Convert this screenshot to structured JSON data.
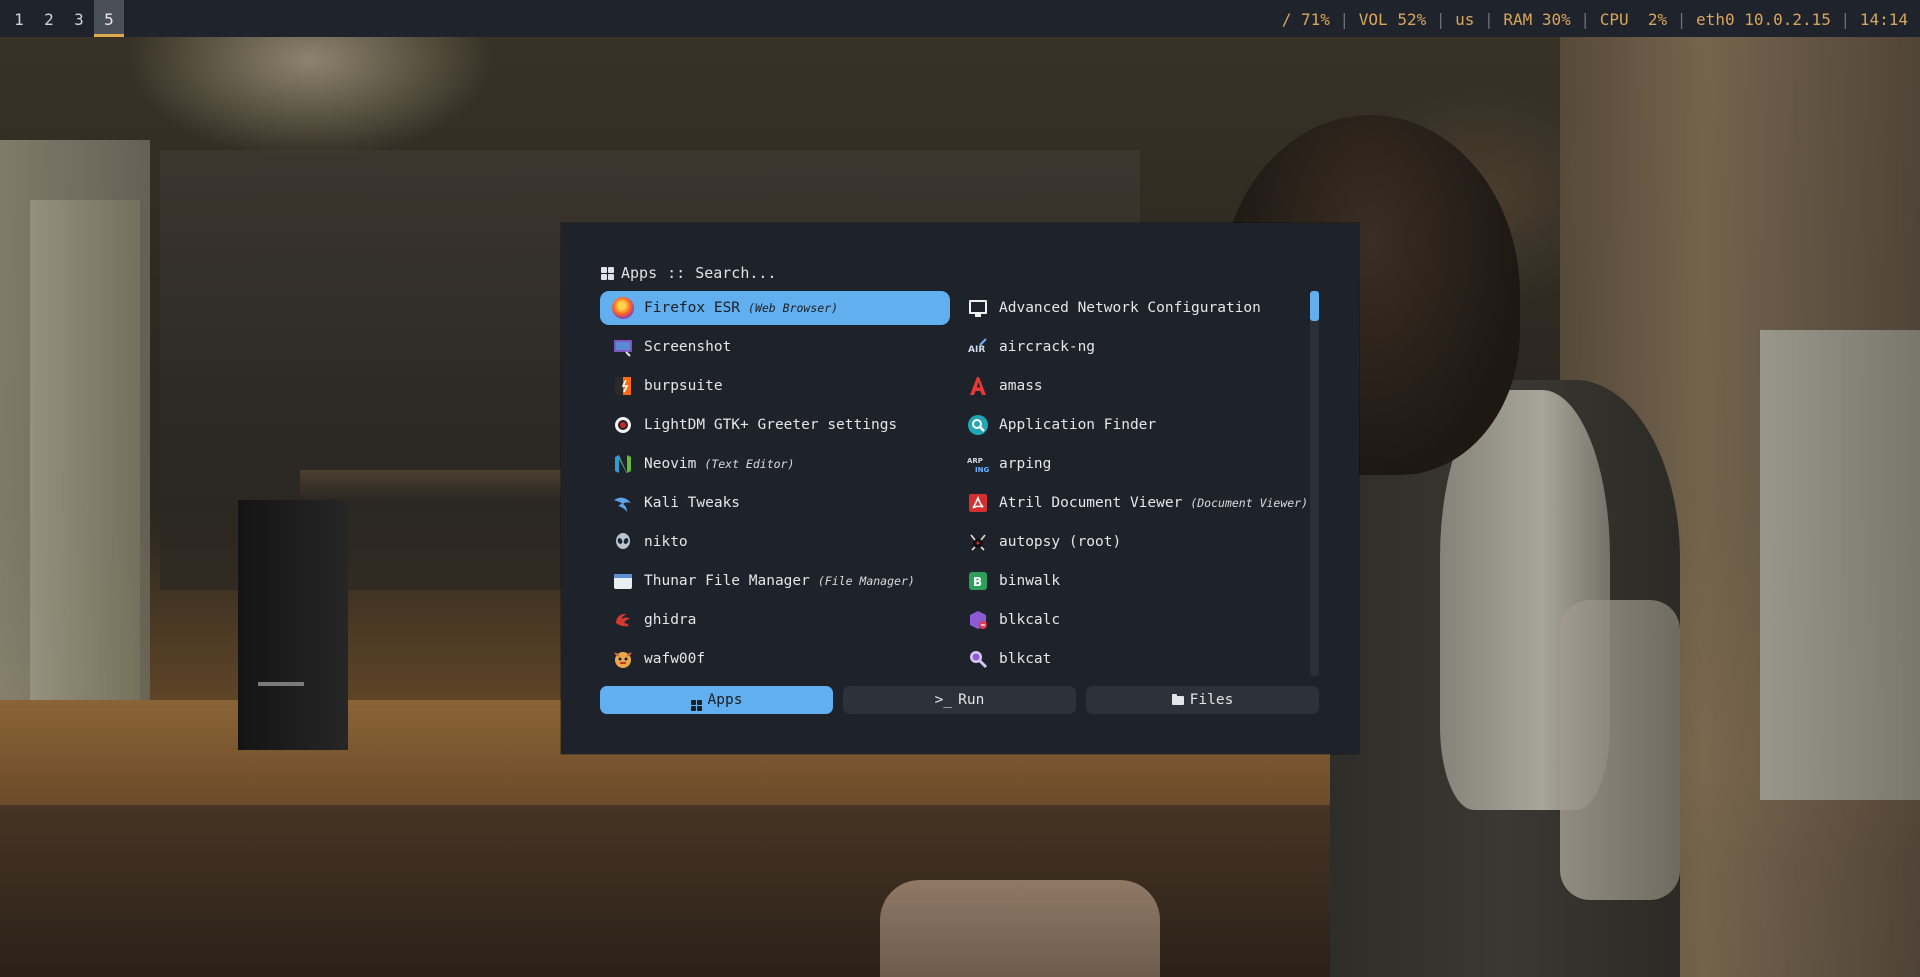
{
  "topbar": {
    "workspaces": [
      "1",
      "2",
      "3",
      "5"
    ],
    "active_workspace": "5",
    "disk": "/ 71%",
    "volume": "VOL 52%",
    "keyboard_layout": "us",
    "ram": "RAM 30%",
    "cpu": "CPU  2%",
    "network": "eth0 10.0.2.15",
    "clock": "14:14",
    "separator": "|",
    "accent_color": "#d9a55c"
  },
  "launcher": {
    "mode_label": "Apps",
    "separator": "::",
    "search_placeholder": "Search...",
    "items_left": [
      {
        "name": "Firefox ESR",
        "desc": "(Web Browser)",
        "icon": "firefox-icon",
        "selected": true
      },
      {
        "name": "Screenshot",
        "desc": "",
        "icon": "screenshot-icon"
      },
      {
        "name": "burpsuite",
        "desc": "",
        "icon": "burpsuite-icon"
      },
      {
        "name": "LightDM GTK+ Greeter settings",
        "desc": "",
        "icon": "lightdm-icon"
      },
      {
        "name": "Neovim",
        "desc": "(Text Editor)",
        "icon": "neovim-icon"
      },
      {
        "name": "Kali Tweaks",
        "desc": "",
        "icon": "kali-dragon-icon"
      },
      {
        "name": "nikto",
        "desc": "",
        "icon": "alien-icon"
      },
      {
        "name": "Thunar File Manager",
        "desc": "(File Manager)",
        "icon": "file-manager-icon"
      },
      {
        "name": "ghidra",
        "desc": "",
        "icon": "ghidra-icon"
      },
      {
        "name": "wafw00f",
        "desc": "",
        "icon": "wafw00f-icon"
      }
    ],
    "items_right": [
      {
        "name": "Advanced Network Configuration",
        "desc": "",
        "icon": "network-config-icon"
      },
      {
        "name": "aircrack-ng",
        "desc": "",
        "icon": "aircrack-icon"
      },
      {
        "name": "amass",
        "desc": "",
        "icon": "amass-icon"
      },
      {
        "name": "Application Finder",
        "desc": "",
        "icon": "app-finder-icon"
      },
      {
        "name": "arping",
        "desc": "",
        "icon": "arping-icon"
      },
      {
        "name": "Atril Document Viewer",
        "desc": "(Document Viewer)",
        "icon": "pdf-viewer-icon"
      },
      {
        "name": "autopsy (root)",
        "desc": "",
        "icon": "autopsy-icon"
      },
      {
        "name": "binwalk",
        "desc": "",
        "icon": "binwalk-icon"
      },
      {
        "name": "blkcalc",
        "desc": "",
        "icon": "blkcalc-icon"
      },
      {
        "name": "blkcat",
        "desc": "",
        "icon": "blkcat-icon"
      }
    ],
    "scroll_position": 0.0,
    "modes": [
      {
        "label": "Apps",
        "active": true
      },
      {
        "label": "Run",
        "prefix": ">_",
        "active": false
      },
      {
        "label": "Files",
        "active": false
      }
    ],
    "colors": {
      "selection": "#61afef",
      "background": "#1e222a",
      "button": "#2c313a"
    }
  }
}
